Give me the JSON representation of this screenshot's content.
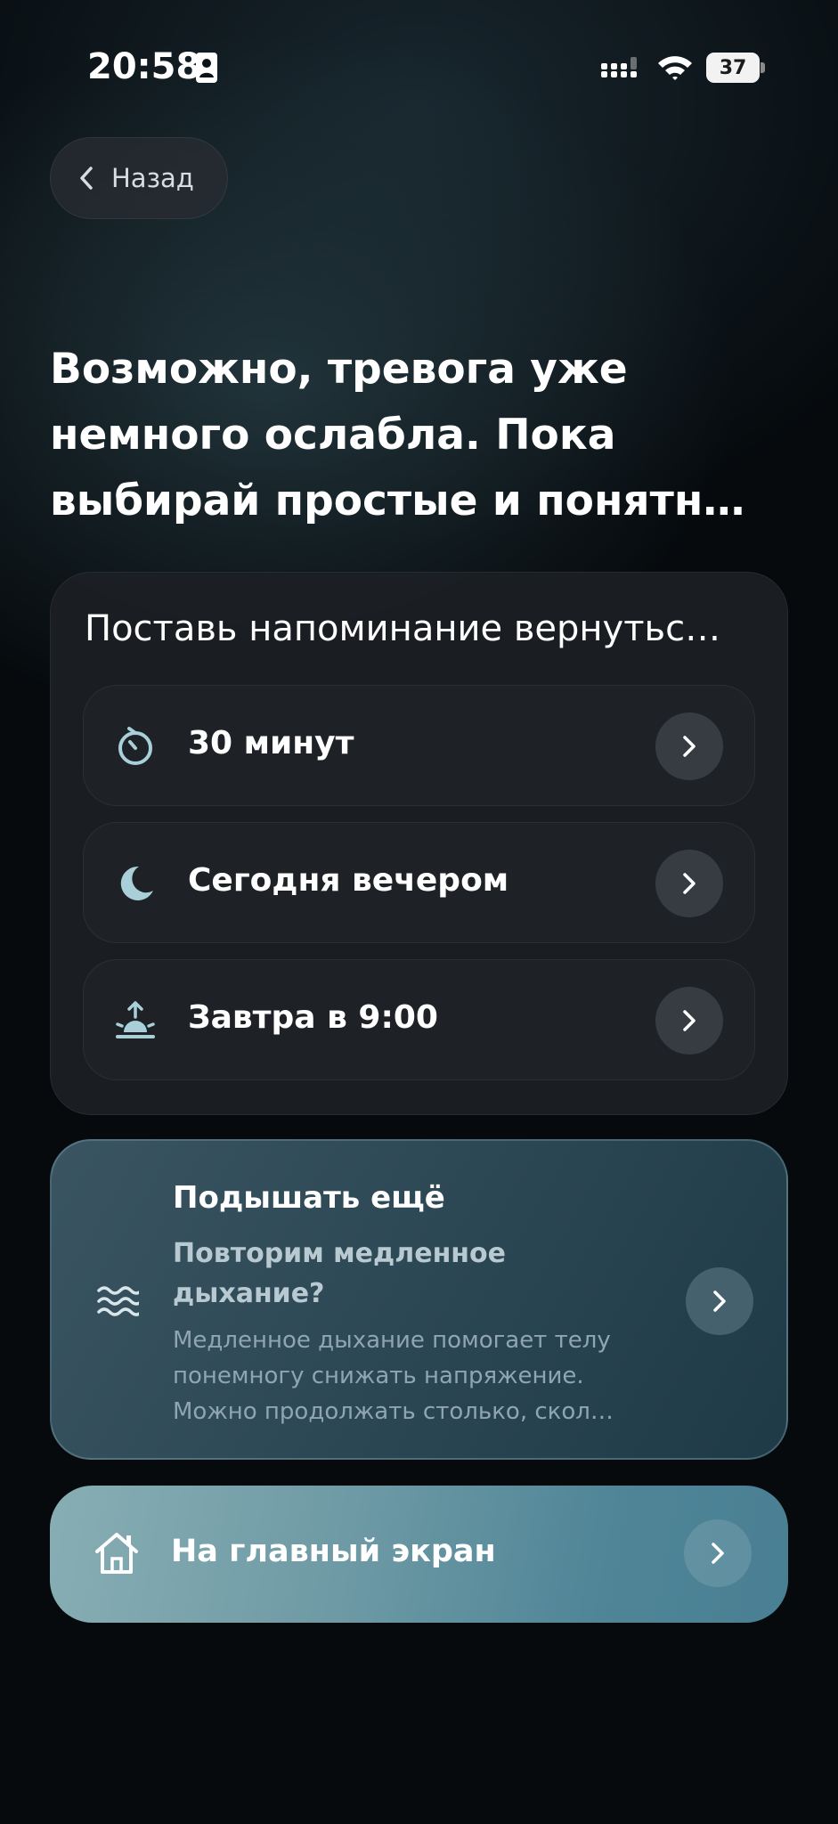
{
  "status_bar": {
    "time": "20:58",
    "battery_level": "37",
    "icons": [
      "contact-card-icon",
      "signal-icon",
      "wifi-icon",
      "battery-icon"
    ]
  },
  "back_button": {
    "label": "Назад",
    "icon": "chevron-left-icon"
  },
  "heading": "Возможно, тревога уже немного ослабла. Пока выбирай простые и понятн…",
  "reminder": {
    "title": "Поставь напоминание вернутьс…",
    "options": [
      {
        "label": "30 минут",
        "icon": "timer-icon"
      },
      {
        "label": "Сегодня вечером",
        "icon": "moon-icon"
      },
      {
        "label": "Завтра в 9:00",
        "icon": "sunrise-icon"
      }
    ]
  },
  "breathe_card": {
    "title": "Подышать ещё",
    "subtitle": "Повторим медленное дыхание?",
    "description": "Медленное дыхание помогает телу понемногу снижать напряжение. Можно продолжать столько, скол…",
    "icon": "waves-icon"
  },
  "home_button": {
    "label": "На главный экран",
    "icon": "home-icon"
  },
  "colors": {
    "background": "#060a0d",
    "card": "#1c1f24",
    "accent_icon": "#a9cfd8",
    "breathe_card": "#2b4653",
    "home_button": "#6e9aa5"
  }
}
